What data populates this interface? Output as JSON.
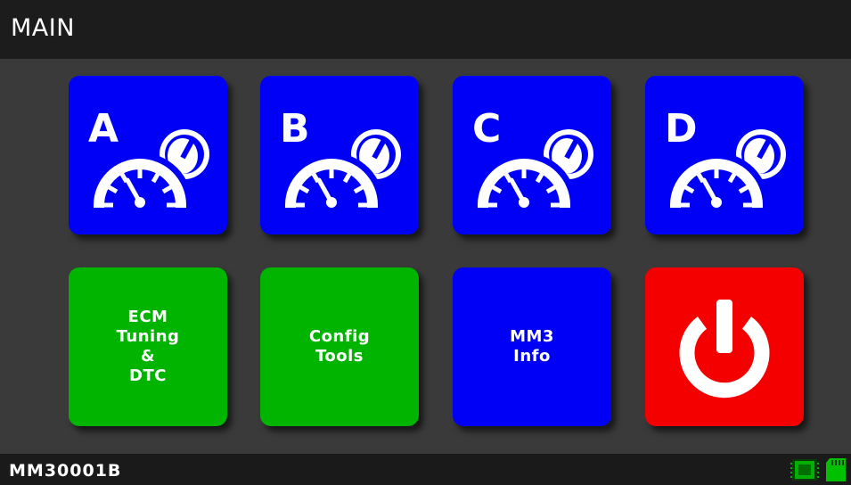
{
  "header": {
    "title": "MAIN"
  },
  "tiles": [
    {
      "letter": "A",
      "icon": "gauge-icon",
      "color": "#0000f7"
    },
    {
      "letter": "B",
      "icon": "gauge-icon",
      "color": "#0000f7"
    },
    {
      "letter": "C",
      "icon": "gauge-icon",
      "color": "#0000f7"
    },
    {
      "letter": "D",
      "icon": "gauge-icon",
      "color": "#0000f7"
    },
    {
      "label": "ECM\nTuning\n&\nDTC",
      "color": "#00b400"
    },
    {
      "label": "Config\nTools",
      "color": "#00b400"
    },
    {
      "label": "MM3\nInfo",
      "color": "#0000f7"
    },
    {
      "icon": "power-icon",
      "color": "#f50000"
    }
  ],
  "status": {
    "device_id": "MM30001B",
    "icons": [
      "chip-icon",
      "sd-card-icon"
    ],
    "icon_color": "#00c000"
  }
}
